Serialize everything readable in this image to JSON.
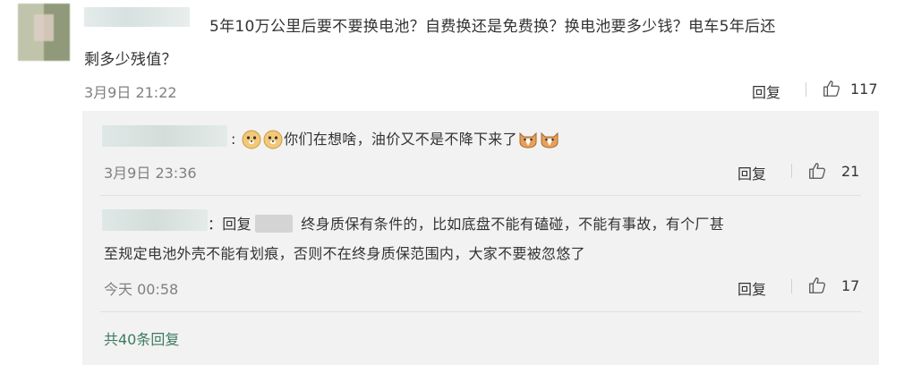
{
  "comment": {
    "text_line1": "5年10万公里后要不要换电池？自费换还是免费换？换电池要多少钱？电车5年后还",
    "text_line2": "剩多少残值？",
    "time": "3月9日 21:22",
    "reply_label": "回复",
    "likes": "117"
  },
  "replies": [
    {
      "colon": ":",
      "text": "你们在想啥，油价又不是不降下来了",
      "time": "3月9日 23:36",
      "reply_label": "回复",
      "likes": "21"
    },
    {
      "prefix": "：回复",
      "text_line1": "终身质保有条件的，比如底盘不能有磕碰，不能有事故，有个厂甚",
      "text_line2": "至规定电池外壳不能有划痕，否则不在终身质保范围内，大家不要被忽悠了",
      "time": "今天 00:58",
      "reply_label": "回复",
      "likes": "17"
    }
  ],
  "more_replies": "共40条回复",
  "colors": {
    "accent_link": "#3d7a60",
    "time_gray": "#808080",
    "reply_bg": "#f2f2f2"
  },
  "icons": {
    "like": "thumbs-up-icon",
    "doge": "doge-emoji",
    "cat": "cat-emoji"
  }
}
